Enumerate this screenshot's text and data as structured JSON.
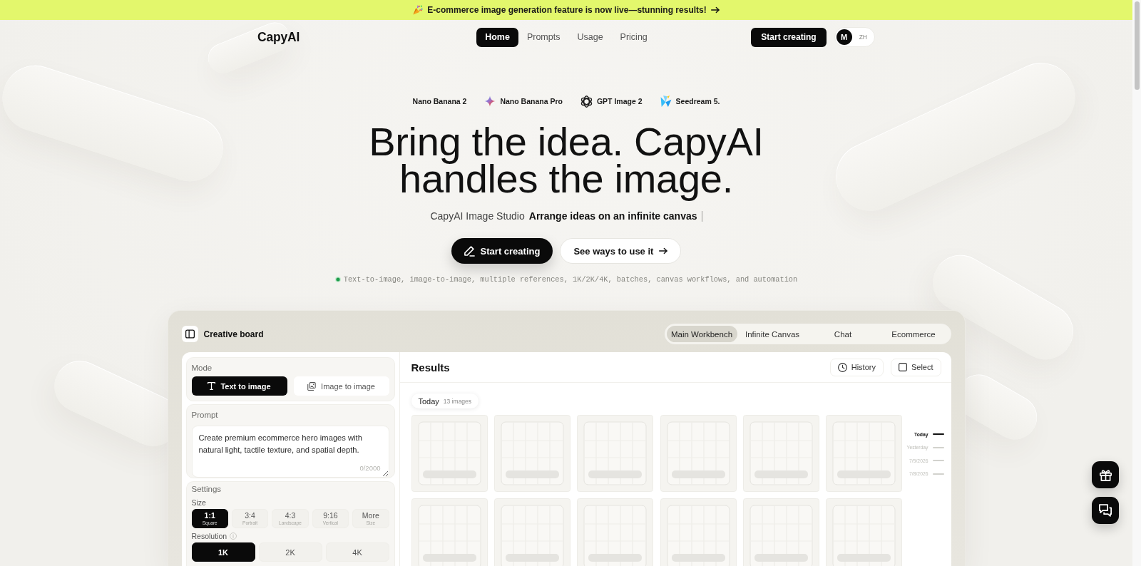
{
  "announcement": {
    "text": "E-commerce image generation feature is now live—stunning results!"
  },
  "nav": {
    "logo": "CapyAI",
    "items": [
      {
        "label": "Home",
        "selected": true
      },
      {
        "label": "Prompts",
        "selected": false
      },
      {
        "label": "Usage",
        "selected": false
      },
      {
        "label": "Pricing",
        "selected": false
      }
    ],
    "cta": "Start creating",
    "language_toggle": [
      {
        "label": "M",
        "selected": true
      },
      {
        "label": "ZH",
        "selected": false
      }
    ]
  },
  "models": [
    {
      "name": "Nano Banana 2"
    },
    {
      "name": "Nano Banana Pro"
    },
    {
      "name": "GPT Image 2"
    },
    {
      "name": "Seedream 5."
    }
  ],
  "hero": {
    "title": "Bring the idea. CapyAI handles the image.",
    "subtitle": {
      "lead": "CapyAI Image Studio",
      "highlight": "Arrange ideas on an infinite canvas"
    },
    "buttons": [
      {
        "label": "Start creating",
        "kind": "primary"
      },
      {
        "label": "See ways to use it",
        "kind": "secondary"
      }
    ],
    "features": "Text-to-image, image-to-image, multiple references, 1K/2K/4K, batches, canvas workflows, and automation"
  },
  "board": {
    "title": "Creative board",
    "tabs": [
      {
        "label": "Main Workbench",
        "selected": true
      },
      {
        "label": "Infinite Canvas",
        "selected": false
      },
      {
        "label": "Chat",
        "selected": false
      },
      {
        "label": "Ecommerce",
        "selected": false
      }
    ],
    "mode": {
      "label": "Mode",
      "options": [
        {
          "label": "Text to image",
          "selected": true
        },
        {
          "label": "Image to image",
          "selected": false
        }
      ]
    },
    "prompt": {
      "label": "Prompt",
      "placeholder": "Create premium ecommerce hero images with natural light, tactile texture, and spatial depth.",
      "counter": "0/2000"
    },
    "settings": {
      "label": "Settings",
      "size": {
        "label": "Size",
        "options": [
          {
            "ratio": "1:1",
            "name": "Square",
            "selected": true
          },
          {
            "ratio": "3:4",
            "name": "Portrait",
            "selected": false
          },
          {
            "ratio": "4:3",
            "name": "Landscape",
            "selected": false
          },
          {
            "ratio": "9:16",
            "name": "Vertical",
            "selected": false
          },
          {
            "ratio": "More",
            "name": "Size",
            "selected": false
          }
        ]
      },
      "resolution": {
        "label": "Resolution",
        "options": [
          {
            "label": "1K",
            "selected": true
          },
          {
            "label": "2K",
            "selected": false
          },
          {
            "label": "4K",
            "selected": false
          }
        ]
      }
    },
    "results": {
      "title": "Results",
      "actions": [
        {
          "label": "History"
        },
        {
          "label": "Select"
        }
      ],
      "group": {
        "label": "Today",
        "count": "13 images"
      },
      "timeline": [
        {
          "label": "Today",
          "selected": true
        },
        {
          "label": "Yesterday",
          "selected": false
        },
        {
          "label": "7/9/2026",
          "selected": false
        },
        {
          "label": "7/8/2026",
          "selected": false
        }
      ]
    }
  }
}
